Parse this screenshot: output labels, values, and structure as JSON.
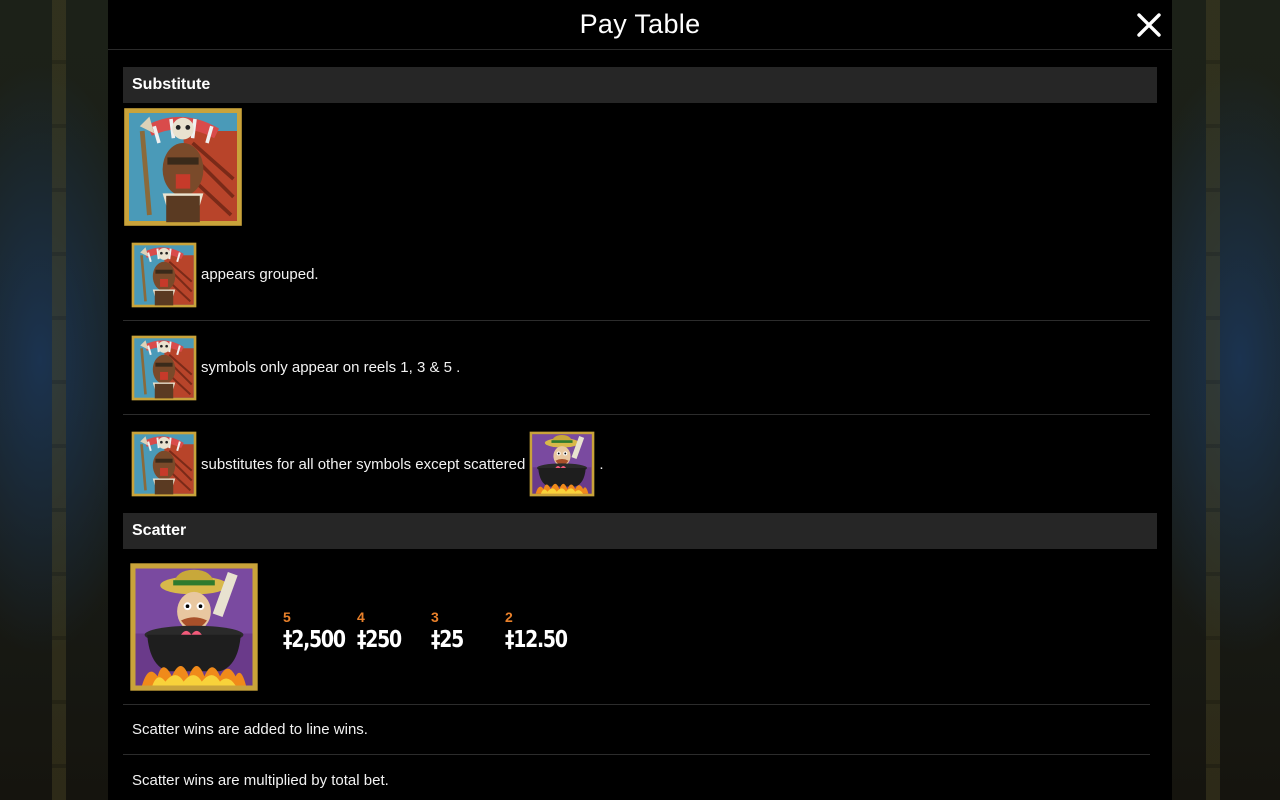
{
  "header": {
    "title": "Pay Table"
  },
  "sections": {
    "substitute": {
      "title": "Substitute",
      "rows": [
        {
          "text": "appears grouped."
        },
        {
          "text": "symbols only appear on reels 1, 3 & 5 ."
        },
        {
          "text": "substitutes for all other symbols except scattered",
          "suffix": "."
        }
      ]
    },
    "scatter": {
      "title": "Scatter",
      "payouts": [
        {
          "count": "5",
          "amount": "‡2,500"
        },
        {
          "count": "4",
          "amount": "‡250"
        },
        {
          "count": "3",
          "amount": "‡25"
        },
        {
          "count": "2",
          "amount": "‡12.50"
        }
      ],
      "notes": [
        "Scatter wins are added to line wins.",
        "Scatter wins are multiplied by total bet."
      ]
    }
  },
  "icons": {
    "close": "close-icon",
    "wild_symbol": "tribal-chief-wild-icon",
    "scatter_symbol": "explorer-in-cauldron-scatter-icon"
  },
  "colors": {
    "panel_bg": "#000000",
    "section_bar": "#262626",
    "payout_count": "#e8802a",
    "text": "#ffffff"
  }
}
